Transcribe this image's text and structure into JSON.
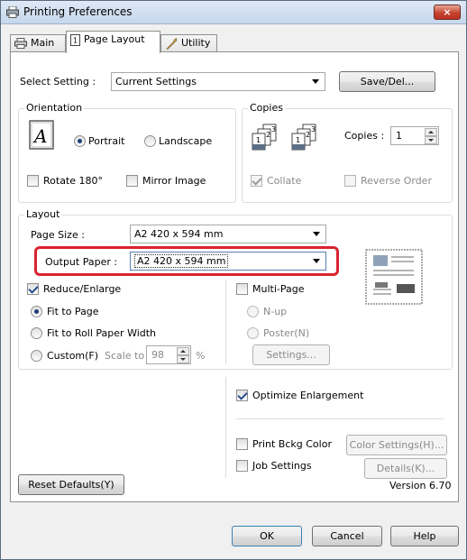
{
  "window": {
    "title": "Printing Preferences",
    "close_label": "×"
  },
  "tabs": [
    {
      "label": "Main",
      "icon": "printer-icon"
    },
    {
      "label": "Page Layout",
      "icon": "page-layout-icon"
    },
    {
      "label": "Utility",
      "icon": "wrench-icon"
    }
  ],
  "select_setting": {
    "label": "Select Setting :",
    "value": "Current Settings",
    "save_label": "Save/Del..."
  },
  "orientation": {
    "group_label": "Orientation",
    "portrait_label": "Portrait",
    "landscape_label": "Landscape",
    "selected": "Portrait",
    "rotate_label": "Rotate 180°",
    "mirror_label": "Mirror Image"
  },
  "copies": {
    "group_label": "Copies",
    "copies_label": "Copies :",
    "copies_value": "1",
    "collate_label": "Collate",
    "collate_checked": true,
    "reverse_label": "Reverse Order"
  },
  "layout": {
    "group_label": "Layout",
    "page_size_label": "Page Size :",
    "page_size_value": "A2 420 x 594 mm",
    "output_paper_label": "Output Paper :",
    "output_paper_value": "A2 420 x 594 mm",
    "reduce_enlarge_label": "Reduce/Enlarge",
    "reduce_enlarge_checked": true,
    "fit_to_page_label": "Fit to Page",
    "fit_roll_label": "Fit to Roll Paper Width",
    "custom_label": "Custom(F)",
    "scale_to_label": "Scale to",
    "scale_value": "98",
    "scale_unit": "%",
    "multi_page_label": "Multi-Page",
    "nup_label": "N-up",
    "poster_label": "Poster(N)",
    "settings_label": "Settings..."
  },
  "options": {
    "optimize_label": "Optimize Enlargement",
    "optimize_checked": true,
    "print_bckg_label": "Print Bckg Color",
    "color_settings_label": "Color Settings(H)...",
    "job_settings_label": "Job Settings",
    "details_label": "Details(K)..."
  },
  "footer": {
    "reset_label": "Reset Defaults(Y)",
    "version": "Version 6.70",
    "ok_label": "OK",
    "cancel_label": "Cancel",
    "help_label": "Help"
  },
  "colors": {
    "highlight": "#d9232e",
    "title_bar": "#c6d6ec",
    "close_button": "#c7442f"
  }
}
